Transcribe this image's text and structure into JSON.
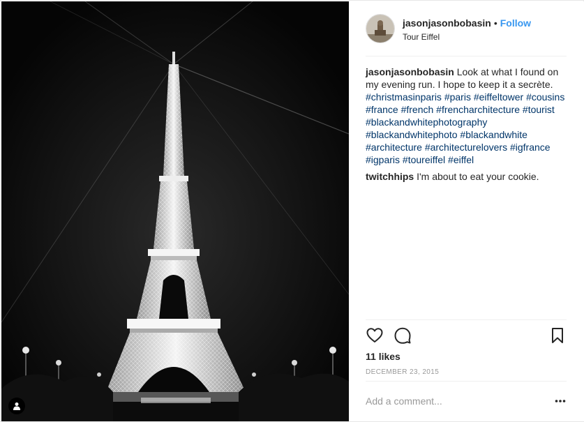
{
  "post": {
    "username": "jasonjasonbobasin",
    "separator": "•",
    "follow_label": "Follow",
    "location": "Tour Eiffel",
    "caption": {
      "user": "jasonjasonbobasin",
      "text": " Look at what I found on my evening run. I hope to keep it a secrète. ",
      "hashtags": "#christmasinparis #paris #eiffeltower #cousins #france #french #frencharchitecture #tourist #blackandwhitephotography #blackandwhitephoto #blackandwhite #architecture #architecturelovers #igfrance #igparis #toureiffel #eiffel"
    },
    "comment": {
      "user": "twitchhips",
      "text": " I'm about to eat your cookie."
    },
    "likes": "11 likes",
    "date": "DECEMBER 23, 2015",
    "add_comment_placeholder": "Add a comment...",
    "icons": {
      "like": "heart-icon",
      "comment": "comment-bubble-icon",
      "save": "bookmark-icon",
      "more": "more-options-icon",
      "tagged": "user-tag-icon"
    },
    "colors": {
      "follow": "#3897f0",
      "hashtag": "#003569",
      "secondary_text": "#999999"
    }
  }
}
